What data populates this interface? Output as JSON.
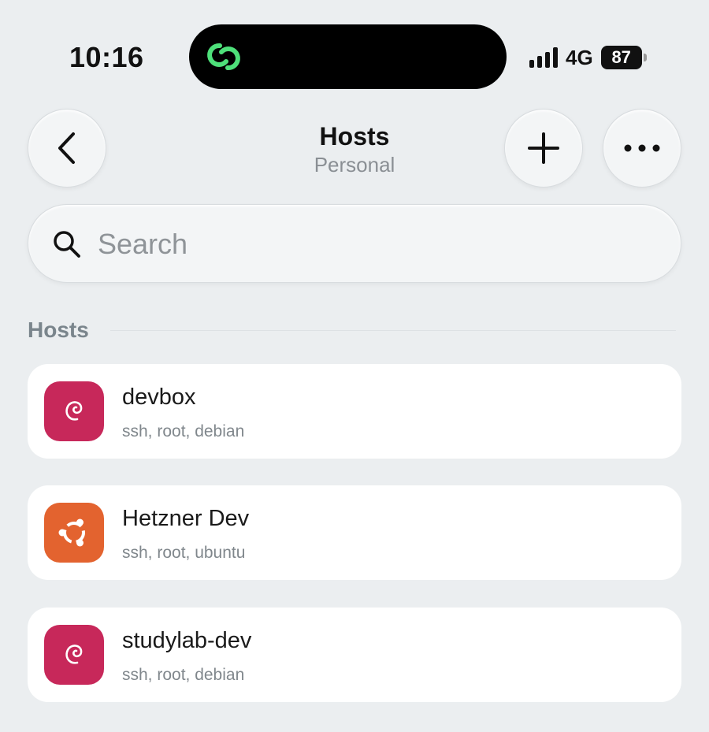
{
  "status_bar": {
    "time": "10:16",
    "network": "4G",
    "battery": "87"
  },
  "header": {
    "title": "Hosts",
    "subtitle": "Personal"
  },
  "search": {
    "placeholder": "Search"
  },
  "section": {
    "label": "Hosts"
  },
  "hosts": [
    {
      "name": "devbox",
      "details": "ssh, root, debian",
      "os": "debian",
      "icon": "debian-icon",
      "color": "#c7285a"
    },
    {
      "name": "Hetzner Dev",
      "details": "ssh, root, ubuntu",
      "os": "ubuntu",
      "icon": "ubuntu-icon",
      "color": "#e3632f"
    },
    {
      "name": "studylab-dev",
      "details": "ssh, root, debian",
      "os": "debian",
      "icon": "debian-icon",
      "color": "#c7285a"
    }
  ],
  "colors": {
    "background": "#ebeef0",
    "debian": "#c7285a",
    "ubuntu": "#e3632f",
    "island_icon": "#4ee07a"
  }
}
